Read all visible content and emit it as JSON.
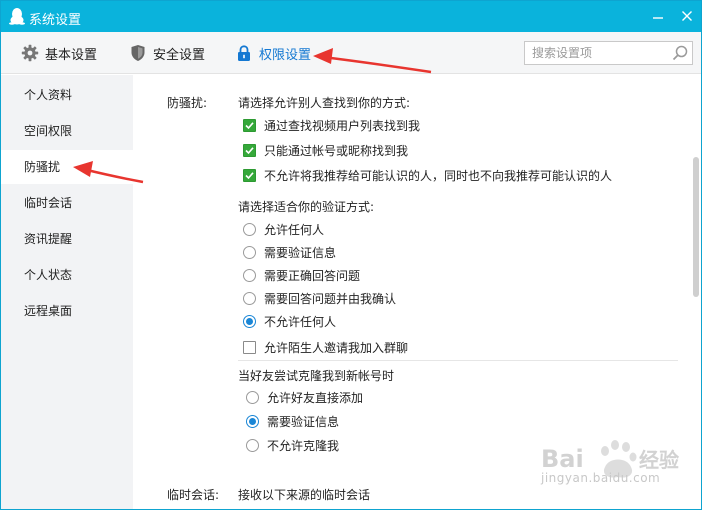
{
  "window": {
    "title": "系统设置"
  },
  "toolbar": {
    "tabs": [
      {
        "label": "基本设置",
        "icon": "gear-icon"
      },
      {
        "label": "安全设置",
        "icon": "shield-icon"
      },
      {
        "label": "权限设置",
        "icon": "lock-icon"
      }
    ],
    "search_placeholder": "搜索设置项"
  },
  "sidebar": {
    "items": [
      {
        "label": "个人资料"
      },
      {
        "label": "空间权限"
      },
      {
        "label": "防骚扰"
      },
      {
        "label": "临时会话"
      },
      {
        "label": "资讯提醒"
      },
      {
        "label": "个人状态"
      },
      {
        "label": "远程桌面"
      }
    ],
    "active_index": 2
  },
  "content": {
    "harass": {
      "label": "防骚扰:",
      "find_title": "请选择允许别人查找到你的方式:",
      "find_options": [
        {
          "label": "通过查找视频用户列表找到我",
          "checked": true
        },
        {
          "label": "只能通过帐号或昵称找到我",
          "checked": true
        },
        {
          "label": "不允许将我推荐给可能认识的人，同时也不向我推荐可能认识的人",
          "checked": true
        }
      ],
      "verify_title": "请选择适合你的验证方式:",
      "verify_options": [
        {
          "label": "允许任何人",
          "selected": false
        },
        {
          "label": "需要验证信息",
          "selected": false
        },
        {
          "label": "需要正确回答问题",
          "selected": false
        },
        {
          "label": "需要回答问题并由我确认",
          "selected": false
        },
        {
          "label": "不允许任何人",
          "selected": true
        }
      ],
      "group_invite": {
        "label": "允许陌生人邀请我加入群聊",
        "checked": false
      },
      "clone_title": "当好友尝试克隆我到新帐号时",
      "clone_options": [
        {
          "label": "允许好友直接添加",
          "selected": false
        },
        {
          "label": "需要验证信息",
          "selected": true
        },
        {
          "label": "不允许克隆我",
          "selected": false
        }
      ]
    },
    "temp": {
      "label": "临时会话:",
      "title": "接收以下来源的临时会话"
    }
  },
  "watermark": {
    "text": "jingyan.baidu.com"
  },
  "colors": {
    "titlebar": "#0ab3dc",
    "accent": "#1478d2",
    "check": "#35a83a",
    "arrow": "#e8352f"
  }
}
